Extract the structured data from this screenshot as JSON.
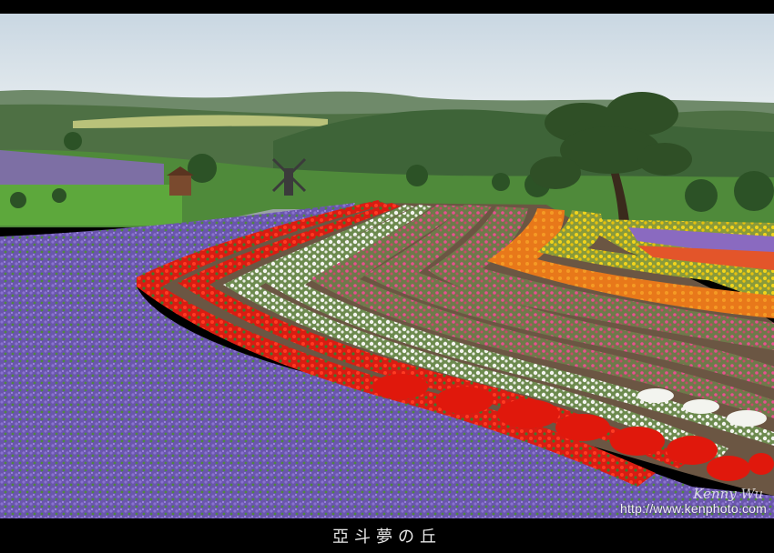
{
  "photo": {
    "description_icon": "landscape-photo",
    "watermark_signature": "Kenny Wu",
    "watermark_url": "http://www.kenphoto.com"
  },
  "caption": {
    "title": "亞斗夢の丘"
  }
}
